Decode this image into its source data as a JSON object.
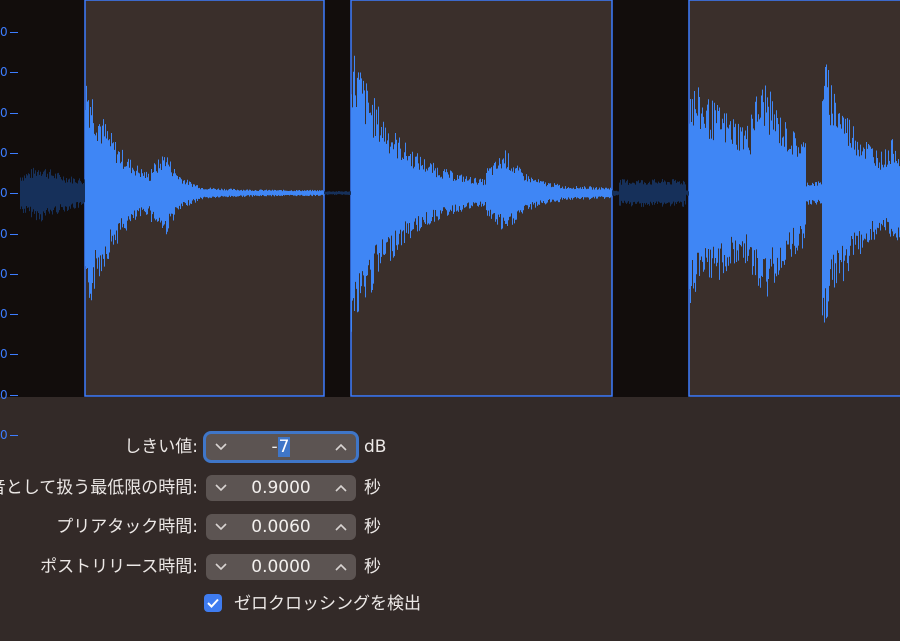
{
  "waveform": {
    "axis_ticks": [
      "0",
      "0",
      "0",
      "0",
      "0",
      "0",
      "0",
      "0",
      "0",
      "0",
      "0"
    ],
    "colors": {
      "waveform_active": "#3f86f5",
      "waveform_inactive": "#16305a",
      "region_bg": "#3a2f2b",
      "gap_bg": "#120d0c",
      "region_border": "#3d7dff"
    }
  },
  "fields": {
    "threshold": {
      "label": "しきい値:",
      "value_prefix": "-",
      "value_selected": "7",
      "unit": "dB"
    },
    "min_time": {
      "label": "音として扱う最低限の時間:",
      "value": "0.9000",
      "unit": "秒"
    },
    "pre_attack": {
      "label": "プリアタック時間:",
      "value": "0.0060",
      "unit": "秒"
    },
    "post_release": {
      "label": "ポストリリース時間:",
      "value": "0.0000",
      "unit": "秒"
    }
  },
  "zero_crossing": {
    "label": "ゼロクロッシングを検出",
    "checked": true
  },
  "icons": {
    "decrement": "chevron-down-icon",
    "increment": "chevron-up-icon",
    "check": "checkmark-icon"
  }
}
